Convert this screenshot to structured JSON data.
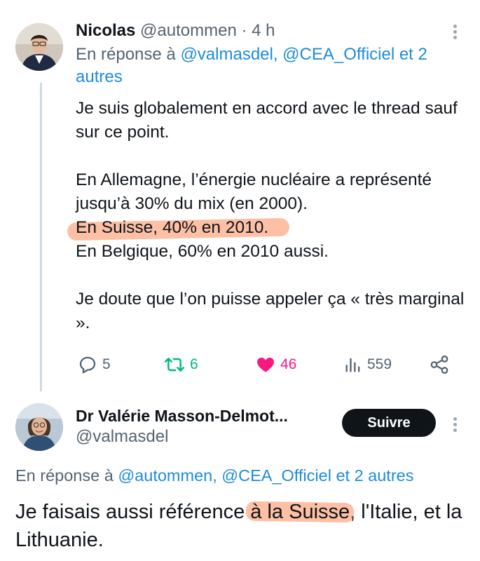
{
  "tweet1": {
    "author_name": "Nicolas",
    "author_handle": "@autommen",
    "separator": " · ",
    "time": "4 h",
    "reply_prefix": "En réponse à ",
    "reply_mentions": "@valmasdel, @CEA_Officiel et 2 autres",
    "body": {
      "line1": "Je suis globalement en accord avec le thread sauf sur ce point.",
      "line2": "En Allemagne, l’énergie nucléaire a représenté jusqu’à 30% du mix (en 2000).",
      "line3": "En Suisse, 40% en 2010.",
      "line4": "En Belgique, 60% en 2010 aussi.",
      "line5": "Je doute que l’on puisse appeler ça « très marginal »."
    },
    "actions": {
      "replies": "5",
      "retweets": "6",
      "likes": "46",
      "views": "559"
    },
    "icons": {
      "reply": "reply-icon",
      "retweet": "retweet-icon",
      "like": "heart-icon",
      "views": "views-icon",
      "share": "share-icon",
      "more": "more-icon"
    }
  },
  "tweet2": {
    "author_name": "Dr Valérie Masson-Delmot...",
    "author_handle": "@valmasdel",
    "follow_label": "Suivre",
    "reply_prefix": "En réponse à ",
    "reply_mentions": "@autommen, @CEA_Officiel et 2 autres",
    "body_before": "Je faisais aussi référence ",
    "body_highlight": "à la Suisse",
    "body_after": ", l'Italie, et la Lithuanie."
  },
  "colors": {
    "accent_link": "#1d9bf0",
    "retweet_green": "#00ba7c",
    "like_pink": "#f91880",
    "muted": "#536471",
    "highlight": "#fc8c5a"
  }
}
